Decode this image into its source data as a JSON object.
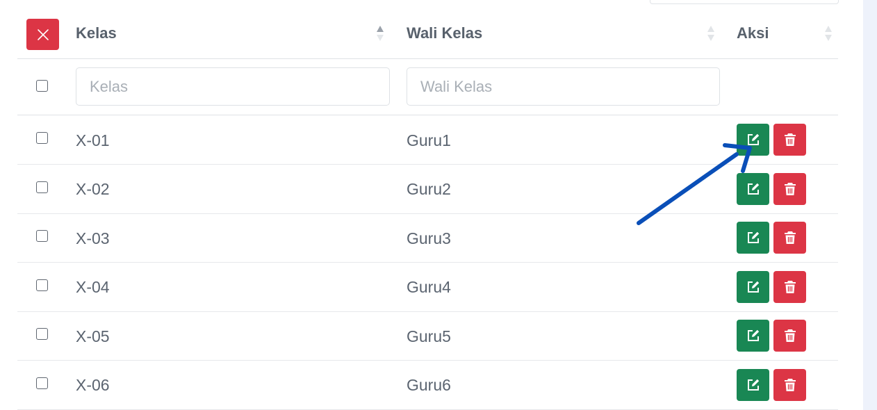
{
  "header": {
    "kelas_label": "Kelas",
    "wali_label": "Wali Kelas",
    "aksi_label": "Aksi"
  },
  "filters": {
    "kelas_placeholder": "Kelas",
    "wali_placeholder": "Wali Kelas"
  },
  "rows": [
    {
      "kelas": "X-01",
      "wali": "Guru1"
    },
    {
      "kelas": "X-02",
      "wali": "Guru2"
    },
    {
      "kelas": "X-03",
      "wali": "Guru3"
    },
    {
      "kelas": "X-04",
      "wali": "Guru4"
    },
    {
      "kelas": "X-05",
      "wali": "Guru5"
    },
    {
      "kelas": "X-06",
      "wali": "Guru6"
    }
  ],
  "icons": {
    "clear": "close-icon",
    "edit": "edit-icon",
    "delete": "trash-icon",
    "sort_active": "sort-asc-icon",
    "sort_idle": "sort-icon"
  },
  "colors": {
    "danger": "#dc3545",
    "success": "#198754",
    "annotation_arrow": "#0a4fb8"
  }
}
